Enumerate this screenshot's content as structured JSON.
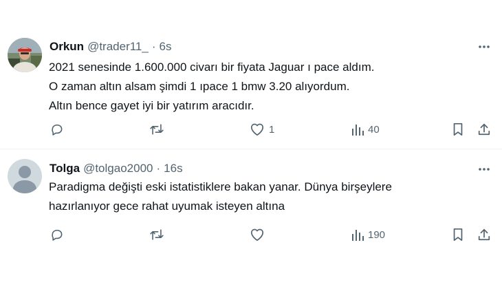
{
  "posts": [
    {
      "author": {
        "name": "Orkun",
        "handle": "@trader11_",
        "time": "6s"
      },
      "separator": "·",
      "lines": [
        "2021 senesinde 1.600.000 civarı bir fiyata Jaguar ı pace aldım.",
        "O zaman altın alsam şimdi 1 ıpace 1 bmw 3.20 alıyordum.",
        "Altın bence gayet iyi bir yatırım aracıdır."
      ],
      "stats": {
        "replies": "",
        "reposts": "",
        "likes": "1",
        "views": "40"
      }
    },
    {
      "author": {
        "name": "Tolga",
        "handle": "@tolgao2000",
        "time": "16s"
      },
      "separator": "·",
      "lines": [
        "Paradigma değişti eski istatistiklere bakan yanar. Dünya birşeylere",
        "hazırlanıyor gece rahat uyumak isteyen altına"
      ],
      "stats": {
        "replies": "",
        "reposts": "",
        "likes": "",
        "views": "190"
      }
    }
  ],
  "icons": {
    "reply": "reply-icon",
    "repost": "repost-icon",
    "like": "heart-icon",
    "views": "views-icon",
    "bookmark": "bookmark-icon",
    "share": "share-icon",
    "more": "more-icon"
  },
  "colors": {
    "text": "#0f1419",
    "secondary": "#536471",
    "divider": "#eff3f4"
  }
}
